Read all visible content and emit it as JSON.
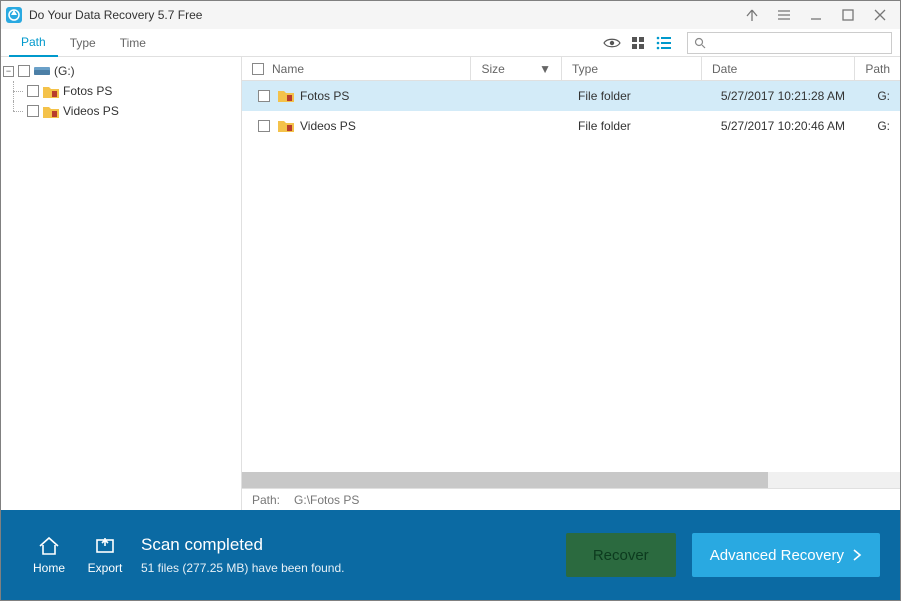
{
  "window": {
    "title": "Do Your Data Recovery 5.7 Free"
  },
  "tabs": {
    "path": "Path",
    "type": "Type",
    "time": "Time"
  },
  "tree": {
    "root_label": "(G:)",
    "children": [
      {
        "label": "Fotos PS"
      },
      {
        "label": "Videos PS"
      }
    ]
  },
  "columns": {
    "name": "Name",
    "size": "Size",
    "type": "Type",
    "date": "Date",
    "path": "Path"
  },
  "rows": [
    {
      "name": "Fotos PS",
      "size": "",
      "type": "File folder",
      "date": "5/27/2017 10:21:28 AM",
      "path": "G:"
    },
    {
      "name": "Videos PS",
      "size": "",
      "type": "File folder",
      "date": "5/27/2017 10:20:46 AM",
      "path": "G:"
    }
  ],
  "pathbar": {
    "label": "Path:",
    "value": "G:\\Fotos PS"
  },
  "footer": {
    "home": "Home",
    "export": "Export",
    "status_title": "Scan completed",
    "status_detail": "51 files (277.25 MB) have been found.",
    "recover": "Recover",
    "advanced": "Advanced Recovery"
  }
}
